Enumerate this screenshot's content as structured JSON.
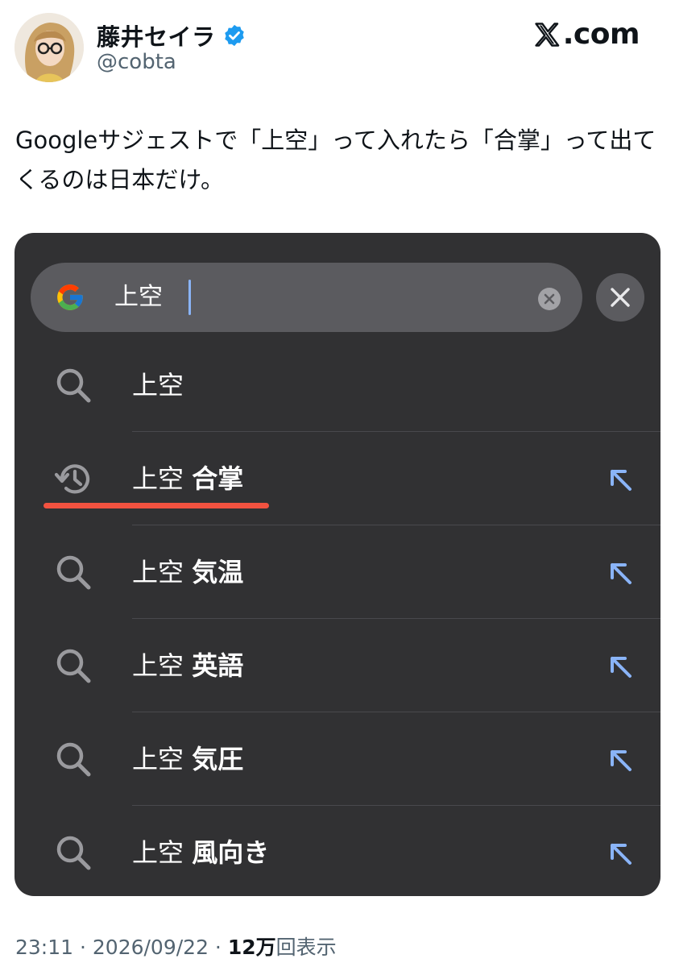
{
  "header": {
    "display_name": "藤井セイラ",
    "handle": "@cobta",
    "verified_icon": "verified-badge-icon",
    "brand_text": ".com",
    "brand_icon": "x-logo-icon"
  },
  "tweet": {
    "text": "Googleサジェストで「上空」って入れたら「合掌」って出てくるのは日本だけ。"
  },
  "search_screen": {
    "query": "上空",
    "colors": {
      "background": "#313133",
      "pill": "#5b5b5f",
      "caret": "#8ab4f8",
      "arrow": "#8ab4f8",
      "highlight": "#f25240"
    },
    "suggestions": [
      {
        "icon": "search-icon",
        "query": "上空",
        "suffix": "",
        "has_fill_arrow": false
      },
      {
        "icon": "history-icon",
        "query": "上空",
        "suffix": "合掌",
        "has_fill_arrow": true,
        "highlighted": true
      },
      {
        "icon": "search-icon",
        "query": "上空",
        "suffix": "気温",
        "has_fill_arrow": true
      },
      {
        "icon": "search-icon",
        "query": "上空",
        "suffix": "英語",
        "has_fill_arrow": true
      },
      {
        "icon": "search-icon",
        "query": "上空",
        "suffix": "気圧",
        "has_fill_arrow": true
      },
      {
        "icon": "search-icon",
        "query": "上空",
        "suffix": "風向き",
        "has_fill_arrow": true
      }
    ]
  },
  "meta": {
    "time": "23:11",
    "separator": " · ",
    "date": "2026/09/22",
    "views_count": "12万",
    "views_label": "回表示"
  }
}
